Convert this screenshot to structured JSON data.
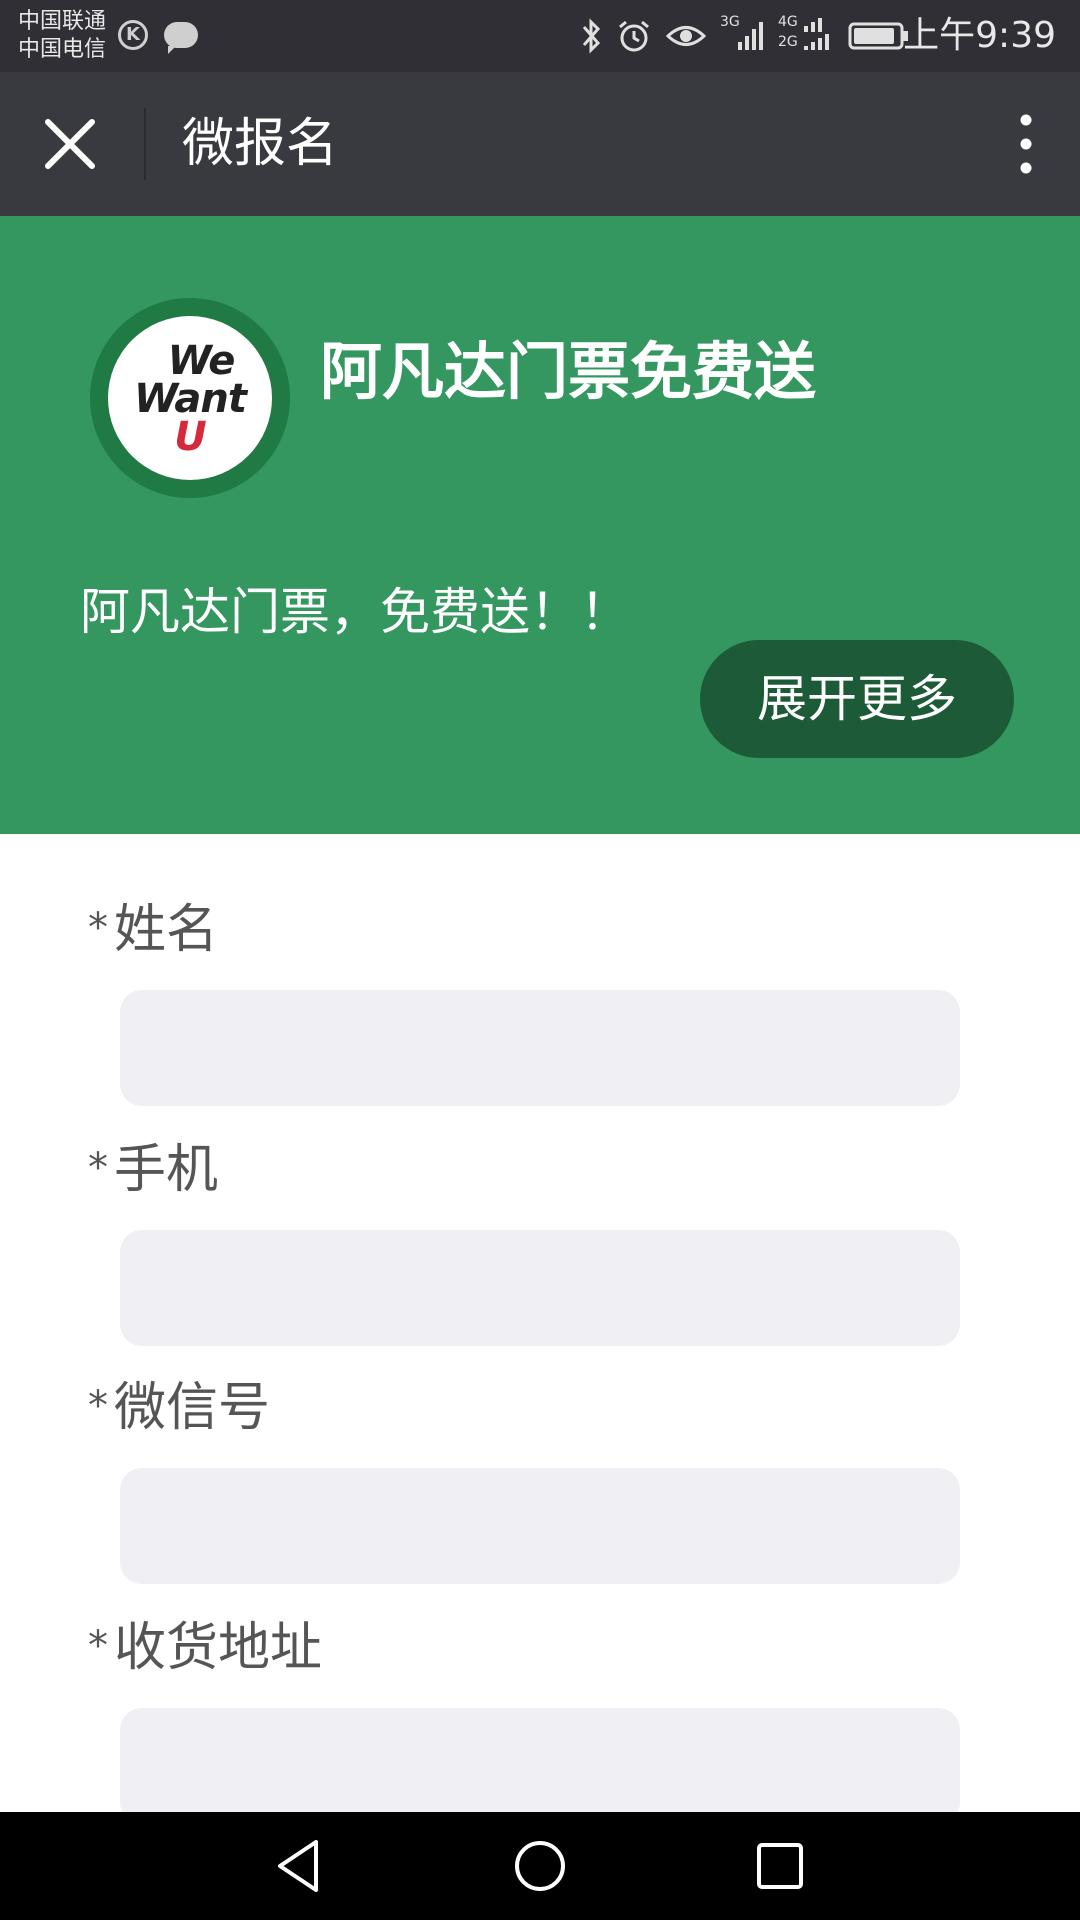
{
  "status_bar": {
    "carrier_line_1": "中国联通",
    "carrier_line_2": "中国电信",
    "carrier_badge": "K",
    "network_3g": "3G",
    "network_4g": "4G",
    "network_2g": "2G",
    "time": "上午9:39",
    "icons": [
      "carrier-k-icon",
      "chat-bubble-icon",
      "bluetooth-icon",
      "alarm-icon",
      "eye-icon",
      "signal-icon",
      "signal-icon",
      "battery-icon"
    ]
  },
  "nav": {
    "title": "微报名",
    "close_icon": "close-icon",
    "more_icon": "more-vertical-icon"
  },
  "hero": {
    "logo_line_1": "We",
    "logo_line_2": "Want",
    "logo_line_3": "U",
    "title": "阿凡达门票免费送",
    "description": "阿凡达门票，免费送！！",
    "expand_button": "展开更多",
    "colors": {
      "background": "#33975f",
      "button": "#1d5a38"
    }
  },
  "form": {
    "required_mark": "*",
    "fields": [
      {
        "label": "姓名",
        "value": ""
      },
      {
        "label": "手机",
        "value": ""
      },
      {
        "label": "微信号",
        "value": ""
      },
      {
        "label": "收货地址",
        "value": ""
      }
    ]
  },
  "android_nav": {
    "icons": [
      "back-icon",
      "home-icon",
      "recents-icon"
    ]
  }
}
